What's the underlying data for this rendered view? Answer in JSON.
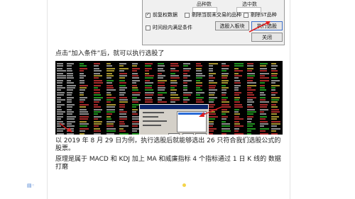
{
  "dialog": {
    "heading_left": "品种数",
    "heading_right": "选中数",
    "checkbox_pre_rights": {
      "label": "前复权数据",
      "checked": true
    },
    "checkbox_delete_untraded": {
      "label": "剔除当前未交易的品种",
      "checked": false
    },
    "checkbox_delete_st": {
      "label": "剔除ST品种",
      "checked": false
    },
    "checkbox_time_period": {
      "label": "时间段内满足条件",
      "checked": false
    },
    "btn_add_to_block": "选股入板块",
    "btn_execute": "执行选股",
    "btn_close": "关闭"
  },
  "caption": "点击“加入条件”后，就可以执行选股了",
  "paragraph1": "以 2019 年 8 月 29 日为例，执行选股后就能够选出 26 只符合我们选股公式的股票。",
  "paragraph2": "原理是属于 MACD 和 KDJ   加上   MA 和威廉指标   4 个指标通过 1 日 K 线的  数据打磨",
  "colors": {
    "up": "#ff4040",
    "down": "#33e033",
    "neutral": "#d8d8d8",
    "highlight": "#ffe24a",
    "accent_arrow": "#e02020"
  }
}
